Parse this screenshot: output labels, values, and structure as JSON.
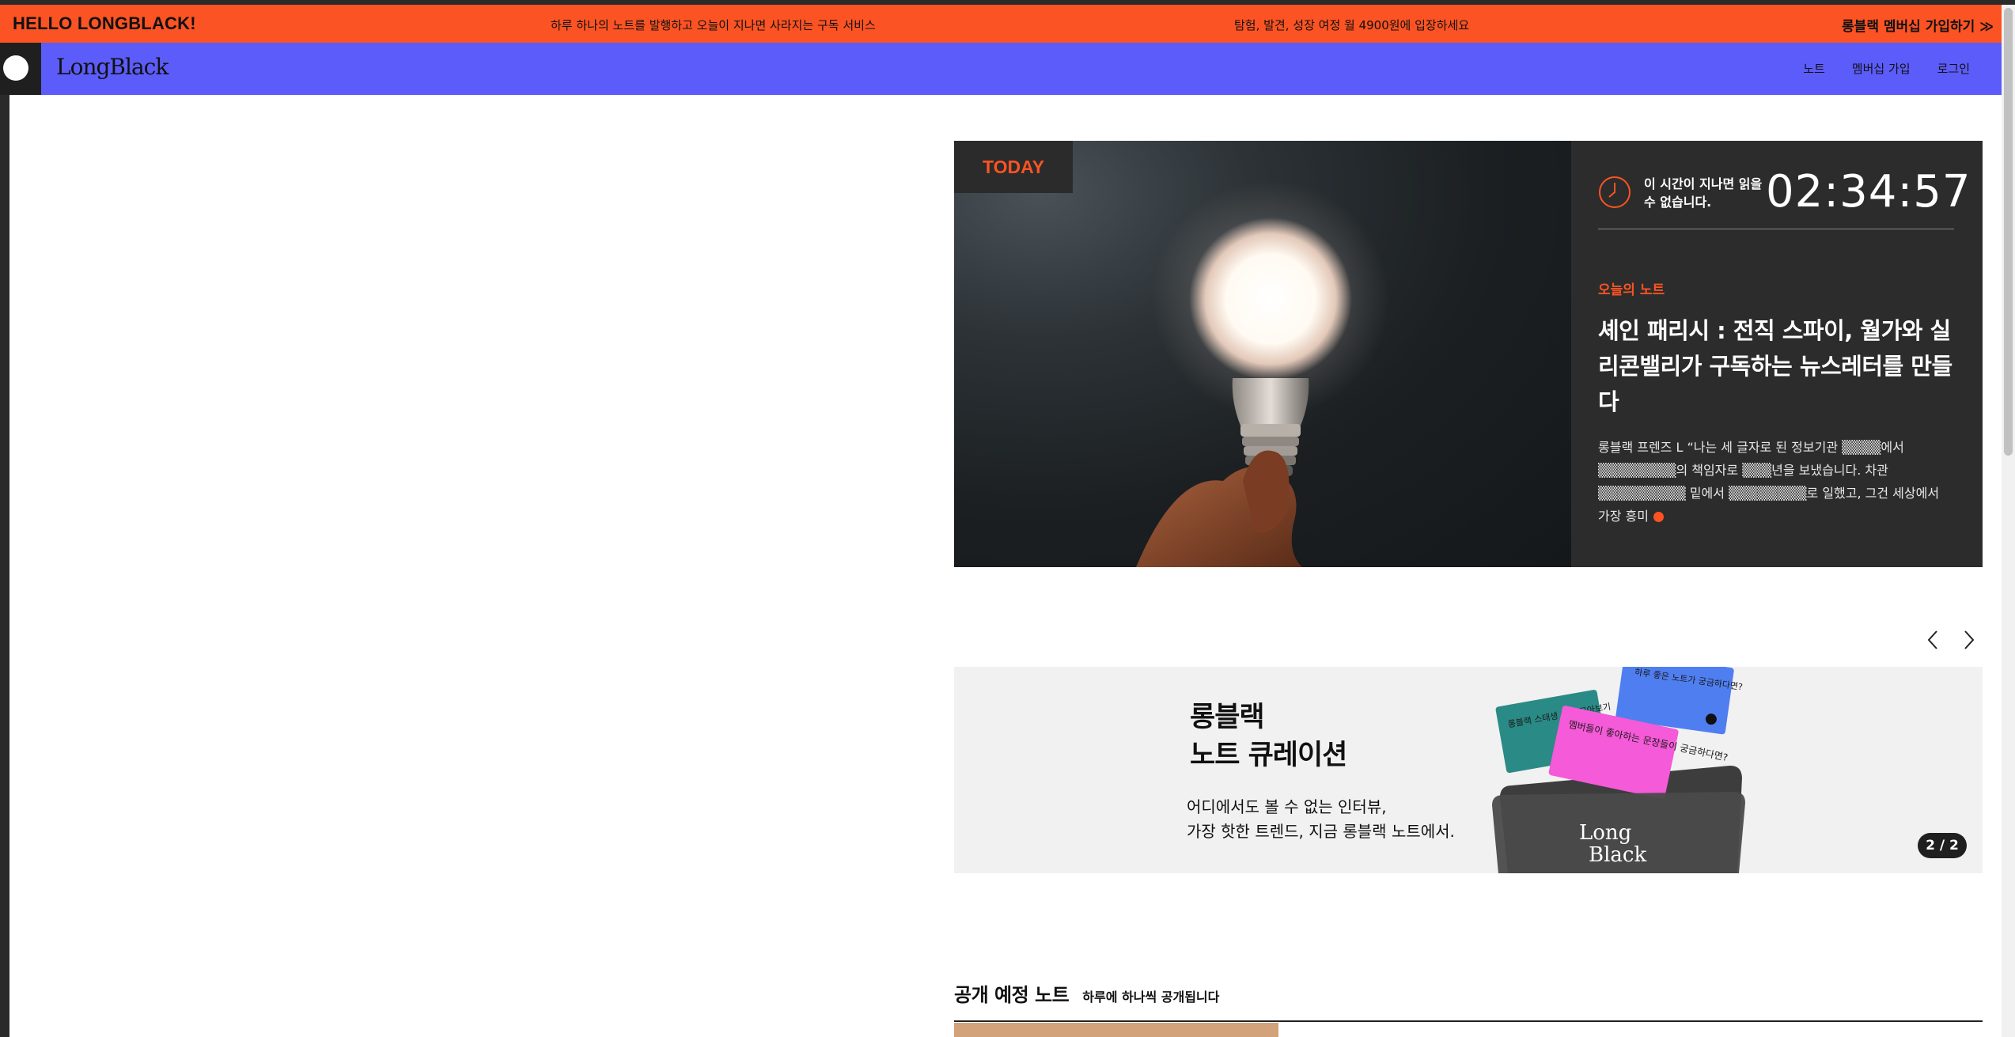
{
  "promo": {
    "brand": "HELLO LONGBLACK!",
    "text_left": "하루 하나의 노트를 발행하고 오늘이 지나면 사라지는 구독 서비스",
    "text_right": "탐험, 발견, 성장 여정 월 4900원에 입장하세요",
    "cta": "롱블랙 멤버십 가입하기 ≫",
    "color": "#fb5323"
  },
  "nav": {
    "logo": "LongBlack",
    "links": [
      "노트",
      "멤버십 가입",
      "로그인"
    ],
    "color": "#5c5cfa"
  },
  "hero": {
    "badge": "TODAY",
    "timer_note": "이 시간이 지나면 읽을 수 없습니다.",
    "timer": "02:34:57",
    "label": "오늘의 노트",
    "title": "셰인 패리시 : 전직 스파이, 월가와 실리콘밸리가 구독하는 뉴스레터를 만들다",
    "excerpt": "롱블랙 프렌즈 L “나는 세 글자로 된 정보기관 ▒▒▒▒에서 ▒▒▒▒▒▒▒▒의 책임자로 ▒▒▒년을 보냈습니다. 차관 ▒▒▒▒▒▒▒▒▒ 밑에서 ▒▒▒▒▒▒▒▒로 일했고, 그건 세상에서 가장 흥미"
  },
  "banner": {
    "title_line1": "롱블랙",
    "title_line2": "노트 큐레이션",
    "sub_line1": "어디에서도 볼 수 없는 인터뷰,",
    "sub_line2": "가장 핫한 트렌드, 지금 롱블랙 노트에서.",
    "card1": "롱블랙 스태생 위크 모아보기",
    "card2": "멤버들이 좋아하는 문장들이 궁금하다면?",
    "card3": "하루 좋은 노트가 궁금하다면?",
    "folder_logo_1": "Long",
    "folder_logo_2": "Black",
    "pager": "2 / 2"
  },
  "upcoming": {
    "title": "공개 예정 노트",
    "sub": "하루에 하나씩 공개됩니다"
  }
}
